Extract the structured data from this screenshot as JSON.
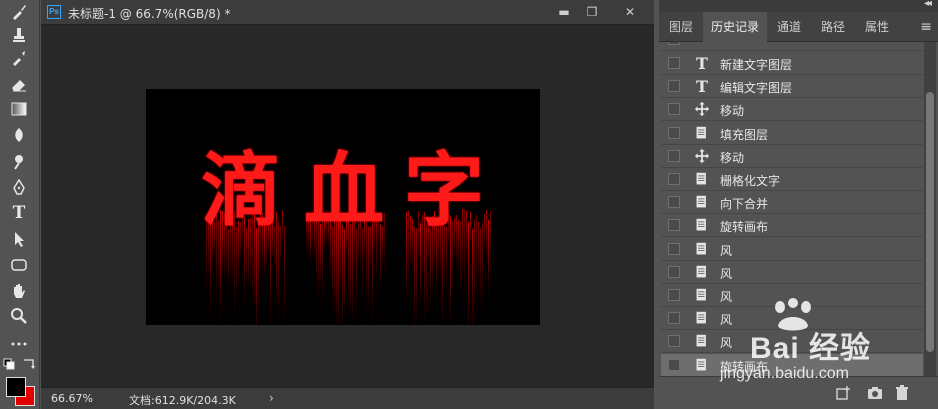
{
  "document": {
    "title": "未标题-1 @ 66.7%(RGB/8) *",
    "app_badge": "Ps",
    "artwork_text": [
      "滴",
      "血",
      "字"
    ],
    "colors": {
      "artwork_red": "#ff1a1a",
      "artboard_bg": "#000000",
      "canvas_bg": "#282828"
    }
  },
  "window_buttons": {
    "minimize": "▬",
    "restore": "❐",
    "close": "✕"
  },
  "statusbar": {
    "zoom": "66.67%",
    "doc_info": "文档:612.9K/204.3K",
    "arrow": "›"
  },
  "panel": {
    "tabs": [
      {
        "label": "图层"
      },
      {
        "label": "历史记录"
      },
      {
        "label": "通道"
      },
      {
        "label": "路径"
      },
      {
        "label": "属性"
      }
    ],
    "active_tab": "历史记录",
    "history": [
      {
        "icon": "type-icon",
        "label": "新建文字图层"
      },
      {
        "icon": "type-icon",
        "label": "编辑文字图层"
      },
      {
        "icon": "move-icon",
        "label": "移动"
      },
      {
        "icon": "document-icon",
        "label": "填充图层"
      },
      {
        "icon": "move-icon",
        "label": "移动"
      },
      {
        "icon": "document-icon",
        "label": "栅格化文字"
      },
      {
        "icon": "document-icon",
        "label": "向下合并"
      },
      {
        "icon": "document-icon",
        "label": "旋转画布"
      },
      {
        "icon": "document-icon",
        "label": "风"
      },
      {
        "icon": "document-icon",
        "label": "风"
      },
      {
        "icon": "document-icon",
        "label": "风"
      },
      {
        "icon": "document-icon",
        "label": "风"
      },
      {
        "icon": "document-icon",
        "label": "风"
      },
      {
        "icon": "document-icon",
        "label": "旋转画布"
      }
    ]
  },
  "watermark": {
    "brand": "Bai 经验",
    "domain": "jingyan.baidu.com"
  }
}
